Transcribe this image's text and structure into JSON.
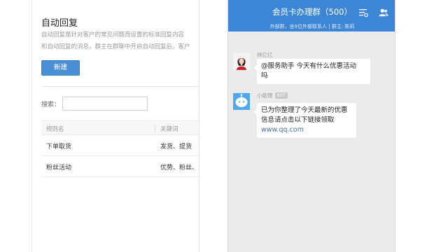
{
  "admin": {
    "title": "自动回复",
    "description_line1": "自动回复是针对客户的常见问题而设置的标准回复内容",
    "description_line2": "和自动回复的消息，群主在群聊中开启自动回复后，客户",
    "new_button": "新建",
    "search": {
      "label": "搜索：",
      "value": "",
      "placeholder": ""
    },
    "table": {
      "columns": [
        "规则名",
        "关键词"
      ],
      "rows": [
        {
          "rule": "下单取货",
          "keywords": "发货、提货"
        },
        {
          "rule": "粉丝活动",
          "keywords": "优势、粉丝、"
        }
      ]
    }
  },
  "chat": {
    "title": "会员卡办理群（500）",
    "subtitle": "外部群，含9位外部联系人 | 群主: 陈莉",
    "header_icons": [
      "list-settings-icon",
      "group-members-icon"
    ],
    "messages": [
      {
        "sender": "林亿亿",
        "avatar": "woman-portrait-avatar",
        "lines": [
          "@服务助手 今天有什么优惠活动",
          "吗"
        ]
      },
      {
        "sender": "小助理",
        "tag": "BOT",
        "avatar": "bot-avatar",
        "lines": [
          "已为你整理了今天最新的优惠",
          "信息请点击以下链接领取"
        ],
        "link": "www.qq.com"
      }
    ]
  },
  "colors": {
    "header_blue": "#3d86d6",
    "button_blue": "#4a8fd6",
    "chat_bg": "#ebebeb",
    "link": "#3d6fb0"
  }
}
